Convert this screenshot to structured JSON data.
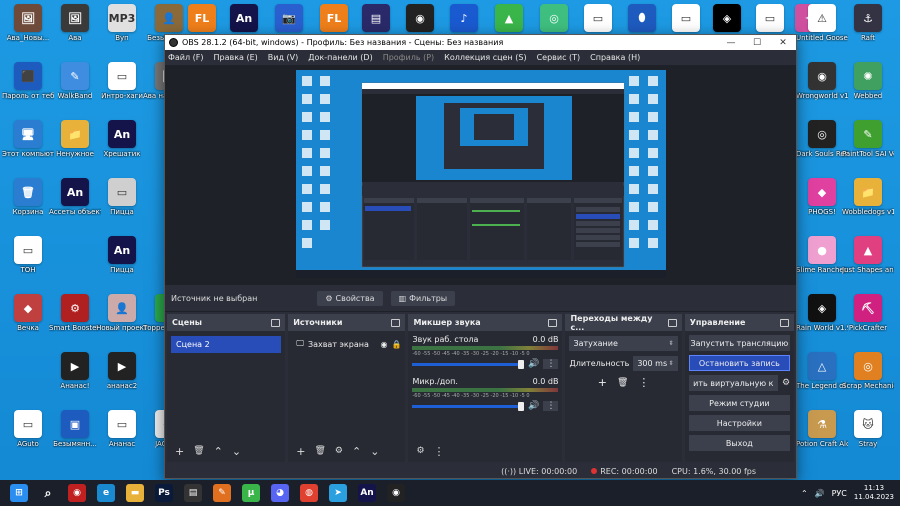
{
  "desktop_icons_left": [
    {
      "label": "Ава_Новы...",
      "icon": "image-icon",
      "color": "#6d4a3a",
      "glyph": "🖼"
    },
    {
      "label": "Ава",
      "icon": "image-icon",
      "color": "#3a3a3a",
      "glyph": "🖼"
    },
    {
      "label": "Вуп",
      "icon": "mp3-icon",
      "color": "#e0e0e0",
      "glyph": "MP3"
    },
    {
      "label": "Безымянн...",
      "icon": "character-icon",
      "color": "#8a6a3a",
      "glyph": "👤"
    },
    {
      "label": "Пароль от тебя",
      "icon": "folder-icon",
      "color": "#1e5bbf",
      "glyph": "⬛"
    },
    {
      "label": "WalkBand",
      "icon": "app-icon",
      "color": "#3f8de0",
      "glyph": "✎"
    },
    {
      "label": "Интро-хаги",
      "icon": "file-icon",
      "color": "#ffffff",
      "glyph": "▭"
    },
    {
      "label": "Ава на переоб...",
      "icon": "image-icon",
      "color": "#777",
      "glyph": "🖼"
    },
    {
      "label": "Этот компьютер",
      "icon": "computer-icon",
      "color": "#2a7dd0",
      "glyph": "🖥"
    },
    {
      "label": "Ненужное",
      "icon": "folder-icon",
      "color": "#e8b23a",
      "glyph": "📁"
    },
    {
      "label": "Хрешатик",
      "icon": "animate-icon",
      "color": "#14134a",
      "glyph": "An"
    },
    {
      "label": "Корзина",
      "icon": "recycle-bin-icon",
      "color": "#2a7dd0",
      "glyph": "🗑"
    },
    {
      "label": "Ассеты объектов",
      "icon": "animate-icon",
      "color": "#14134a",
      "glyph": "An"
    },
    {
      "label": "Пицца",
      "icon": "image-icon",
      "color": "#cfcfcf",
      "glyph": "▭"
    },
    {
      "label": "ТОН",
      "icon": "file-icon",
      "color": "#ffffff",
      "glyph": "▭"
    },
    {
      "label": "Пицца",
      "icon": "animate-icon",
      "color": "#14134a",
      "glyph": "An"
    },
    {
      "label": "Вечка",
      "icon": "game-icon",
      "color": "#c04040",
      "glyph": "◆"
    },
    {
      "label": "Smart Booster 10",
      "icon": "booster-icon",
      "color": "#b02020",
      "glyph": "⚙"
    },
    {
      "label": "Новый проект",
      "icon": "character-icon",
      "color": "#caa",
      "glyph": "👤"
    },
    {
      "label": "Торрент Игрух...",
      "icon": "torrent-icon",
      "color": "#2aa84a",
      "glyph": "T"
    },
    {
      "label": "Ананас!",
      "icon": "video-icon",
      "color": "#222",
      "glyph": "▶"
    },
    {
      "label": "ананас2",
      "icon": "video-icon",
      "color": "#222",
      "glyph": "▶"
    },
    {
      "label": "AGuto",
      "icon": "file-icon",
      "color": "#ffffff",
      "glyph": "▭"
    },
    {
      "label": "Безымянн...",
      "icon": "app-icon",
      "color": "#1e5bbf",
      "glyph": "▣"
    },
    {
      "label": "Ананас",
      "icon": "file-icon",
      "color": "#ffffff",
      "glyph": "▭"
    },
    {
      "label": "JAGKA...",
      "icon": "character-icon",
      "color": "#eee",
      "glyph": "🐱"
    }
  ],
  "desktop_icons_top": [
    {
      "icon": "fl-studio-icon",
      "color": "#ef7f1a",
      "glyph": "FL"
    },
    {
      "icon": "animate-icon",
      "color": "#14134a",
      "glyph": "An"
    },
    {
      "icon": "camera-icon",
      "color": "#2a5fd0",
      "glyph": "📷"
    },
    {
      "icon": "fl-studio-icon",
      "color": "#ef7f1a",
      "glyph": "FL"
    },
    {
      "icon": "app-icon",
      "color": "#2a2a6a",
      "glyph": "▤"
    },
    {
      "icon": "obs-icon",
      "color": "#222",
      "glyph": "◉"
    },
    {
      "icon": "audio-icon",
      "color": "#1a5ad0",
      "glyph": "♪"
    },
    {
      "icon": "bluestacks-icon",
      "color": "#3ab54a",
      "glyph": "▲"
    },
    {
      "icon": "game-icon",
      "color": "#3fbf7f",
      "glyph": "◎"
    },
    {
      "icon": "file-icon",
      "color": "#ffffff",
      "glyph": "▭"
    },
    {
      "icon": "mouse-icon",
      "color": "#1e5bbf",
      "glyph": "⬮"
    },
    {
      "icon": "file-icon",
      "color": "#ffffff",
      "glyph": "▭"
    },
    {
      "icon": "geometry-icon",
      "color": "#000",
      "glyph": "◈"
    },
    {
      "icon": "file-icon",
      "color": "#ffffff",
      "glyph": "▭"
    },
    {
      "icon": "bird-icon",
      "color": "#d050a0",
      "glyph": "✦"
    }
  ],
  "desktop_icons_right": [
    {
      "label": "Untitled Goose Game",
      "icon": "warning-icon",
      "color": "#ffffff",
      "glyph": "⚠"
    },
    {
      "label": "Raft",
      "icon": "raft-icon",
      "color": "#334",
      "glyph": "⚓"
    },
    {
      "label": "Wrongworld v1.5.2",
      "icon": "game-icon",
      "color": "#333",
      "glyph": "◉"
    },
    {
      "label": "Webbed",
      "icon": "game-icon",
      "color": "#3fa060",
      "glyph": "✺"
    },
    {
      "label": "Dark Souls Remastered",
      "icon": "game-icon",
      "color": "#222",
      "glyph": "◎"
    },
    {
      "label": "PaintTool SAI Ver.1",
      "icon": "paint-icon",
      "color": "#3fa030",
      "glyph": "✎"
    },
    {
      "label": "PHOGS!",
      "icon": "game-icon",
      "color": "#e040a0",
      "glyph": "◆"
    },
    {
      "label": "Wobbledogs v1.04.00",
      "icon": "folder-icon",
      "color": "#e8b23a",
      "glyph": "📁"
    },
    {
      "label": "Slime Rancher 2",
      "icon": "game-icon",
      "color": "#f0a0d0",
      "glyph": "●"
    },
    {
      "label": "Just Shapes and Beats-...",
      "icon": "game-icon",
      "color": "#e04080",
      "glyph": "▲"
    },
    {
      "label": "Rain World v1.9.03 D...",
      "icon": "game-icon",
      "color": "#111",
      "glyph": "◈"
    },
    {
      "label": "PickCrafter",
      "icon": "pickaxe-icon",
      "color": "#d02080",
      "glyph": "⛏"
    },
    {
      "label": "The Legend of Zelda -...",
      "icon": "game-icon",
      "color": "#2a70c0",
      "glyph": "△"
    },
    {
      "label": "Scrap Mechanic",
      "icon": "game-icon",
      "color": "#e08020",
      "glyph": "◎"
    },
    {
      "label": "Potion Craft Alchemist ...",
      "icon": "game-icon",
      "color": "#c89a50",
      "glyph": "⚗"
    },
    {
      "label": "Stray",
      "icon": "cat-icon",
      "color": "#ffffff",
      "glyph": "🐱"
    }
  ],
  "window": {
    "title": "OBS 28.1.2 (64-bit, windows) - Профиль: Без названия - Сцены: Без названия",
    "minimize": "—",
    "maximize": "☐",
    "close": "✕"
  },
  "menu": [
    {
      "label": "Файл (F)",
      "disabled": false
    },
    {
      "label": "Правка (E)",
      "disabled": false
    },
    {
      "label": "Вид (V)",
      "disabled": false
    },
    {
      "label": "Док-панели (D)",
      "disabled": false
    },
    {
      "label": "Профиль (P)",
      "disabled": true
    },
    {
      "label": "Коллекция сцен (S)",
      "disabled": false
    },
    {
      "label": "Сервис (T)",
      "disabled": false
    },
    {
      "label": "Справка (H)",
      "disabled": false
    }
  ],
  "source_bar": {
    "no_source": "Источник не выбран",
    "properties": "Свойства",
    "filters": "Фильтры"
  },
  "docks": {
    "scenes": {
      "title": "Сцены",
      "items": [
        "Сцена 2"
      ]
    },
    "sources": {
      "title": "Источники",
      "items": [
        "Захват экрана"
      ]
    },
    "mixer": {
      "title": "Микшер звука",
      "channels": [
        {
          "name": "Звук раб. стола",
          "db": "0.0 dB"
        },
        {
          "name": "Микр./доп.",
          "db": "0.0 dB"
        }
      ],
      "scale": "-60 -55 -50 -45 -40 -35 -30 -25 -20 -15 -10 -5 0"
    },
    "transitions": {
      "title": "Переходы между с...",
      "selected": "Затухание",
      "duration_label": "Длительность",
      "duration_value": "300 ms"
    },
    "controls": {
      "title": "Управление",
      "buttons": [
        {
          "label": "Запустить трансляцию",
          "active": false
        },
        {
          "label": "Остановить запись",
          "active": true
        },
        {
          "label": "ить виртуальную к",
          "active": false
        },
        {
          "label": "Режим студии",
          "active": false
        },
        {
          "label": "Настройки",
          "active": false
        },
        {
          "label": "Выход",
          "active": false
        }
      ]
    }
  },
  "status": {
    "live": "LIVE: 00:00:00",
    "rec": "REC: 00:00:00",
    "cpu": "CPU: 1.6%, 30.00 fps"
  },
  "taskbar": [
    {
      "icon": "windows-start-icon",
      "color": "#2a8df0",
      "glyph": "⊞"
    },
    {
      "icon": "search-icon",
      "color": "transparent",
      "glyph": "⌕"
    },
    {
      "icon": "app-icon",
      "color": "#c02020",
      "glyph": "◉"
    },
    {
      "icon": "edge-icon",
      "color": "#1a8ad0",
      "glyph": "e"
    },
    {
      "icon": "file-explorer-icon",
      "color": "#e8b23a",
      "glyph": "▬"
    },
    {
      "icon": "photoshop-icon",
      "color": "#0a1a3a",
      "glyph": "Ps"
    },
    {
      "icon": "app-icon",
      "color": "#333",
      "glyph": "▤"
    },
    {
      "icon": "pen-icon",
      "color": "#e07020",
      "glyph": "✎"
    },
    {
      "icon": "utorrent-icon",
      "color": "#3ab54a",
      "glyph": "μ"
    },
    {
      "icon": "discord-icon",
      "color": "#5865f2",
      "glyph": "◕"
    },
    {
      "icon": "chrome-icon",
      "color": "#e04030",
      "glyph": "◍"
    },
    {
      "icon": "telegram-icon",
      "color": "#2aa0e0",
      "glyph": "➤"
    },
    {
      "icon": "animate-icon",
      "color": "#14134a",
      "glyph": "An"
    },
    {
      "icon": "obs-icon",
      "color": "#222",
      "glyph": "◉"
    }
  ],
  "tray": {
    "lang": "РУС",
    "time": "11:13",
    "date": "11.04.2023"
  }
}
